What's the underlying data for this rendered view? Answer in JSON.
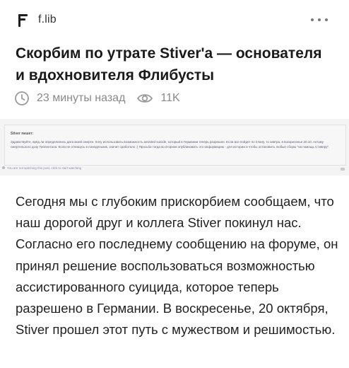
{
  "header": {
    "site_name": "f.lib",
    "logo_icon": "flib-logo-icon",
    "menu_icon": "more-horizontal-icon"
  },
  "article": {
    "title": "Скорбим по утрате Stiver'a — основателя и вдохновителя Флибусты",
    "time_ago": "23 минуты назад",
    "views": "11K",
    "time_icon": "clock-icon",
    "views_icon": "eye-icon",
    "body": "Сегодня мы с глубоким прискорбием сообщаем, что наш дорогой друг и коллега Stiver покинул нас. Согласно его последнему сообщению на форуме, он принял решение воспользоваться возможностью ассистированного суицида, которое теперь разрешено в Германии. В воскресенье, 20 октября, Stiver прошел этот путь с мужеством и решимостью."
  },
  "forum_screenshot": {
    "author": "Stiver пишет:",
    "text": "Здравствуйте, вряд ли определились дата моей смерти. Хочу использовать возможность assisted suicide, который в Германии теперь разрешен. Если все пойдет по плану, то завтра, в воскресенье 20.10. потому смертельного дозу Тиопентала. Если не отпишусь в понедельник, значит сработало :) Просьба тогда во вторник опубликовать это информацию - для истории и чтобы остановить любые сборы \"на помощь Стиверу\".",
    "footer": "You are not watching this post, click to start watching"
  },
  "colors": {
    "text": "#1f1f1f",
    "meta": "#8a8a8a",
    "forum_bg": "#f4f4f5"
  }
}
